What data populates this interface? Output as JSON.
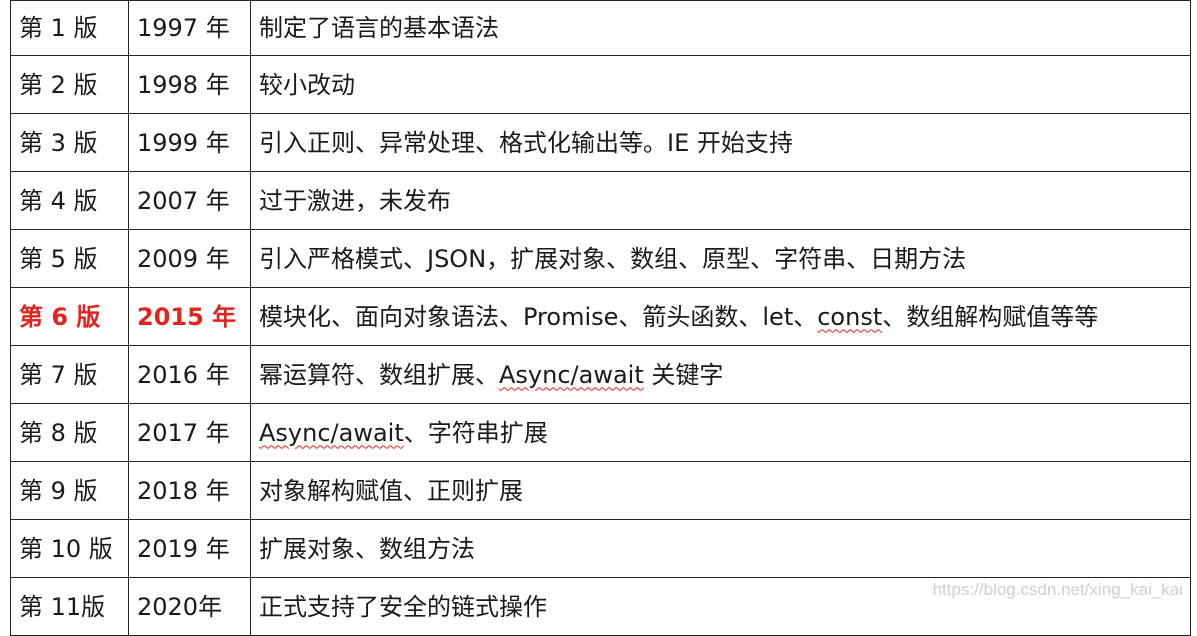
{
  "rows": [
    {
      "version": "第 1 版",
      "year": "1997 年",
      "parts": [
        {
          "text": "制定了语言的基本语法"
        }
      ]
    },
    {
      "version": "第 2 版",
      "year": "1998 年",
      "parts": [
        {
          "text": "较小改动"
        }
      ]
    },
    {
      "version": "第 3 版",
      "year": "1999 年",
      "parts": [
        {
          "text": "引入正则、异常处理、格式化输出等。IE 开始支持"
        }
      ]
    },
    {
      "version": "第 4 版",
      "year": "2007 年",
      "parts": [
        {
          "text": "过于激进，未发布"
        }
      ]
    },
    {
      "version": "第 5 版",
      "year": "2009 年",
      "parts": [
        {
          "text": "引入严格模式、JSON，扩展对象、数组、原型、字符串、日期方法"
        }
      ]
    },
    {
      "version": "第 6 版",
      "year": "2015 年",
      "highlight": true,
      "parts": [
        {
          "text": "模块化、面向对象语法、Promise、箭头函数、let、"
        },
        {
          "text": "const",
          "squiggle": true
        },
        {
          "text": "、数组解构赋值等等"
        }
      ]
    },
    {
      "version": "第 7 版",
      "year": "2016 年",
      "parts": [
        {
          "text": "幂运算符、数组扩展、"
        },
        {
          "text": "Async/await",
          "squiggle": true
        },
        {
          "text": " 关键字"
        }
      ]
    },
    {
      "version": "第 8 版",
      "year": "2017 年",
      "parts": [
        {
          "text": "Async/await",
          "squiggle": true
        },
        {
          "text": "、字符串扩展"
        }
      ]
    },
    {
      "version": "第 9 版",
      "year": "2018 年",
      "parts": [
        {
          "text": "对象解构赋值、正则扩展"
        }
      ]
    },
    {
      "version": "第 10 版",
      "year": "2019 年",
      "parts": [
        {
          "text": "扩展对象、数组方法"
        }
      ]
    },
    {
      "version": "第 11版",
      "year": "2020年",
      "parts": [
        {
          "text": "正式支持了安全的链式操作"
        }
      ]
    }
  ],
  "watermark": "https://blog.csdn.net/xing_kai_kai",
  "colors": {
    "highlight": "#e3231e",
    "border": "#222222",
    "squiggle": "#e3231e"
  }
}
